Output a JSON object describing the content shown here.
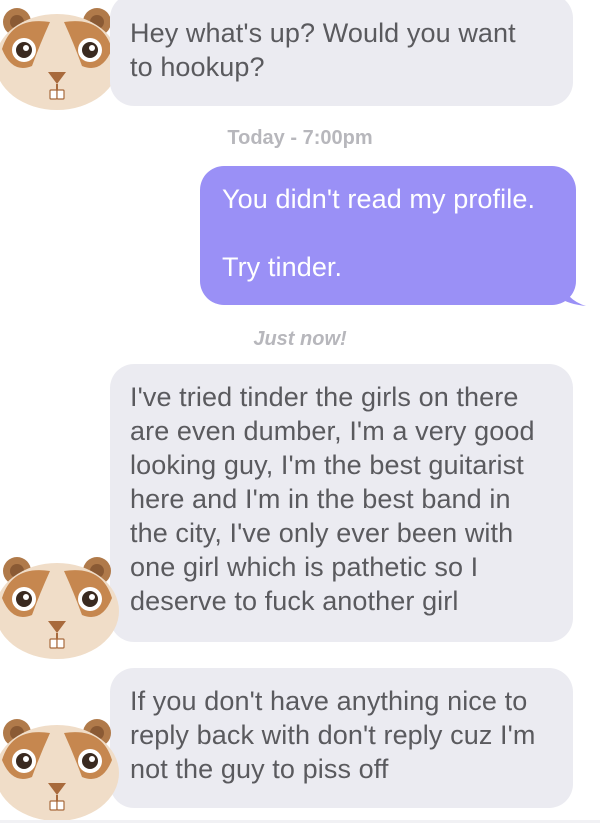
{
  "messages": [
    {
      "sender": "them",
      "text": "Hey what's up? Would you want\nto hookup?"
    },
    {
      "sender": "me",
      "text": "You didn't read my profile.\n\nTry tinder."
    },
    {
      "sender": "them",
      "text": "I've tried tinder the girls on there\nare even dumber, I'm a very good\nlooking guy, I'm the best guitarist\nhere and I'm in the best band in\nthe city, I've only ever been with\none girl which is pathetic so I\ndeserve to fuck another girl"
    },
    {
      "sender": "them",
      "text": "If you don't have anything nice to\nreply back with don't reply cuz I'm\nnot the guy to piss off"
    }
  ],
  "timestamps": {
    "first": "Today - 7:00pm",
    "second": "Just now!"
  },
  "avatar": {
    "icon": "hamster-avatar-icon"
  },
  "colors": {
    "incoming_bubble": "#ebebf1",
    "outgoing_bubble": "#9a90f6",
    "timestamp": "#b7b7bc"
  }
}
